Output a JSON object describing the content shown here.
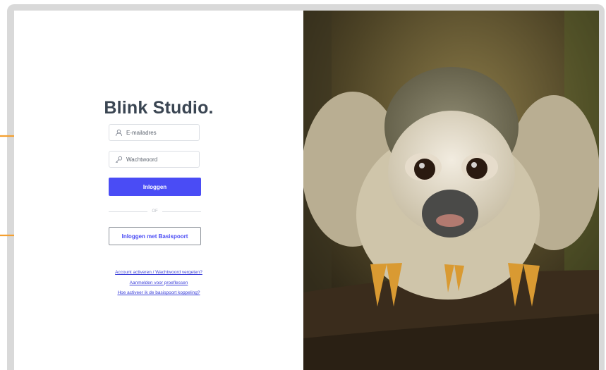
{
  "brand": {
    "title": "Blink Studio."
  },
  "login": {
    "email_placeholder": "E-mailadres",
    "password_placeholder": "Wachtwoord",
    "login_label": "Inloggen",
    "divider_label": "OF",
    "basispoort_label": "Inloggen met Basispoort"
  },
  "links": [
    "Account activeren / Wachtwoord vergeten?",
    "Aanmelden voor proeflessen",
    "Hoe activeer ik de basispoort koppeling?"
  ],
  "icons": {
    "email": "user-icon",
    "password": "key-icon",
    "annotation": "arrow-right-icon"
  },
  "colors": {
    "primary": "#4a4cf5",
    "annotation_arrow": "#f5a030",
    "title": "#3a4552"
  }
}
